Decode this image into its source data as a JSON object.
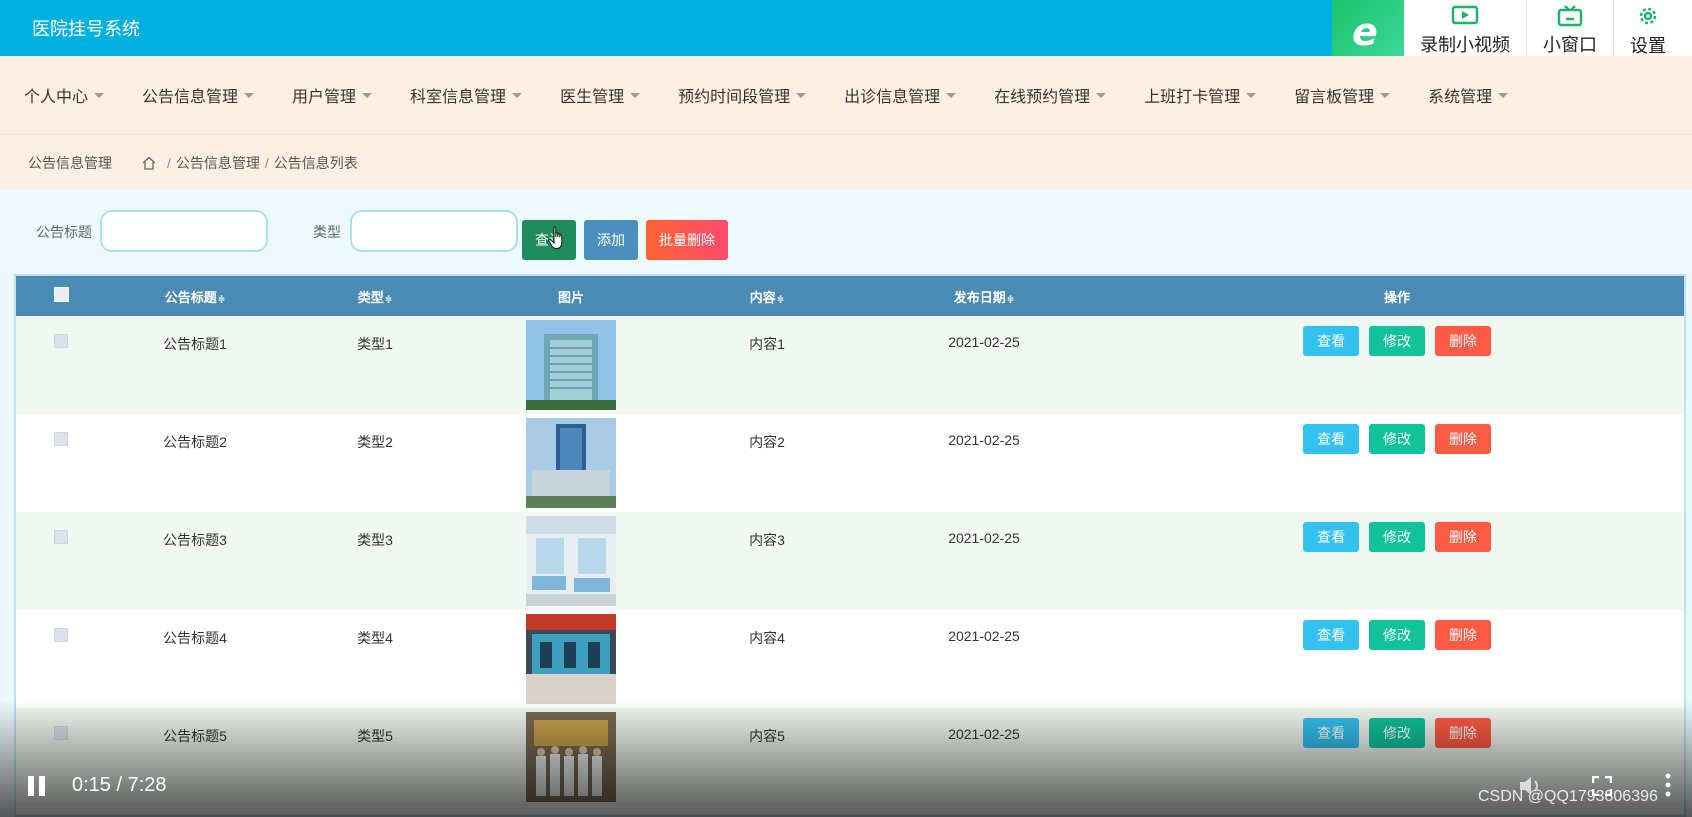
{
  "app": {
    "title": "医院挂号系统"
  },
  "extension": {
    "items": [
      {
        "label": "录制小视频",
        "icon": "video-record-icon"
      },
      {
        "label": "小窗口",
        "icon": "tv-window-icon"
      },
      {
        "label": "设置",
        "icon": "gear-icon"
      }
    ],
    "logo_letter": "e"
  },
  "nav": {
    "items": [
      {
        "label": "个人中心"
      },
      {
        "label": "公告信息管理"
      },
      {
        "label": "用户管理"
      },
      {
        "label": "科室信息管理"
      },
      {
        "label": "医生管理"
      },
      {
        "label": "预约时间段管理"
      },
      {
        "label": "出诊信息管理"
      },
      {
        "label": "在线预约管理"
      },
      {
        "label": "上班打卡管理"
      },
      {
        "label": "留言板管理"
      },
      {
        "label": "系统管理"
      }
    ]
  },
  "breadcrumb": {
    "title": "公告信息管理",
    "sep": "/",
    "path": [
      "公告信息管理",
      "公告信息列表"
    ]
  },
  "search": {
    "title_label": "公告标题",
    "title_value": "",
    "type_label": "类型",
    "type_value": "",
    "search_button": "查询",
    "add_button": "添加",
    "bulk_delete_button": "批量删除"
  },
  "table": {
    "headers": {
      "title": "公告标题",
      "type": "类型",
      "image": "图片",
      "content": "内容",
      "date": "发布日期",
      "actions": "操作"
    },
    "sort_glyph": "≑",
    "action_labels": {
      "view": "查看",
      "edit": "修改",
      "delete": "删除"
    },
    "rows": [
      {
        "title": "公告标题1",
        "type": "类型1",
        "content": "内容1",
        "date": "2021-02-25",
        "image": "hospital-tower-photo"
      },
      {
        "title": "公告标题2",
        "type": "类型2",
        "content": "内容2",
        "date": "2021-02-25",
        "image": "hospital-blue-building-photo"
      },
      {
        "title": "公告标题3",
        "type": "类型3",
        "content": "内容3",
        "date": "2021-02-25",
        "image": "hospital-ward-photo"
      },
      {
        "title": "公告标题4",
        "type": "类型4",
        "content": "内容4",
        "date": "2021-02-25",
        "image": "hospital-counter-photo"
      },
      {
        "title": "公告标题5",
        "type": "类型5",
        "content": "内容5",
        "date": "2021-02-25",
        "image": "medical-staff-group-photo"
      }
    ]
  },
  "video": {
    "time": "0:15 / 7:28",
    "watermark": "CSDN @QQ1793806396"
  },
  "colors": {
    "topbar": "#00b0e0",
    "nav_bg": "#fdf0e2",
    "table_header": "#4a8bb3",
    "view": "#33c1f0",
    "edit": "#10c39b",
    "delete": "#ff5a44"
  }
}
